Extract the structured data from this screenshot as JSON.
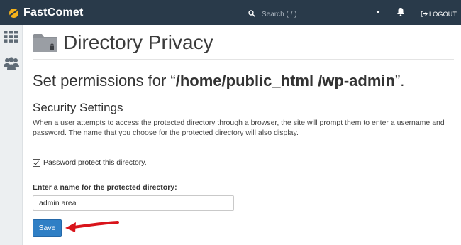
{
  "header": {
    "brand": "FastComet",
    "search_placeholder": "Search ( / )",
    "logout_label": "LOGOUT"
  },
  "sidebar": {
    "icons": [
      "grid-icon",
      "users-icon"
    ]
  },
  "page": {
    "title": "Directory Privacy",
    "permissions_prefix": "Set permissions for “",
    "permissions_path": "/home/public_html /wp-admin",
    "permissions_suffix": "”."
  },
  "security": {
    "title": "Security Settings",
    "description": "When a user attempts to access the protected directory through a browser, the site will prompt them to enter a username and password. The name that you choose for the protected directory will also display.",
    "password_protect_label": "Password protect this directory.",
    "password_protect_checked": true,
    "name_label": "Enter a name for the protected directory:",
    "name_value": "admin area",
    "save_label": "Save"
  },
  "colors": {
    "topbar": "#293a4a",
    "logo_accent": "#f6b21a",
    "primary_button": "#2f7fc5",
    "annotation_arrow": "#d9141b"
  }
}
